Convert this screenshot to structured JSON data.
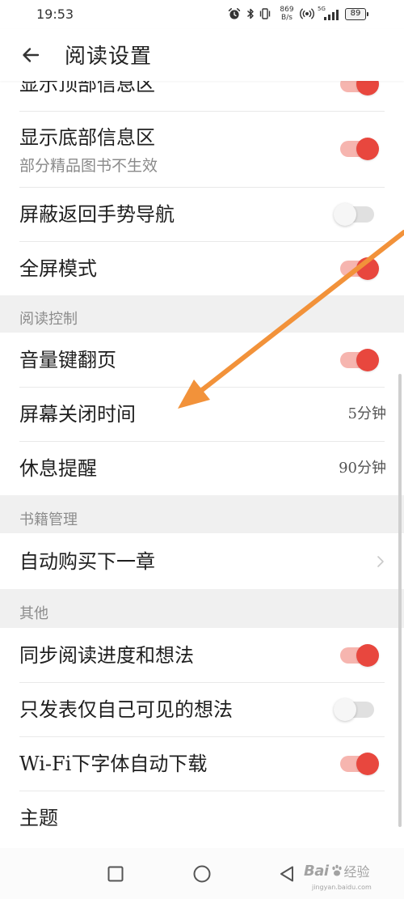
{
  "status_bar": {
    "time": "19:53",
    "net_speed_value": "869",
    "net_speed_unit": "B/s",
    "network_type": "5G",
    "battery": "89",
    "icons": [
      "alarm-icon",
      "bluetooth-icon",
      "vibrate-icon",
      "hotspot-icon",
      "signal-icon",
      "battery-icon"
    ]
  },
  "header": {
    "back_icon": "back-arrow-icon",
    "title": "阅读设置"
  },
  "sections": [
    {
      "items": [
        {
          "label": "显示顶部信息区",
          "toggle_on": true
        },
        {
          "label": "显示底部信息区",
          "sublabel": "部分精品图书不生效",
          "toggle_on": true
        },
        {
          "label": "屏蔽返回手势导航",
          "toggle_on": false
        },
        {
          "label": "全屏模式",
          "toggle_on": true
        }
      ]
    },
    {
      "header": "阅读控制",
      "items": [
        {
          "label": "音量键翻页",
          "toggle_on": true
        },
        {
          "label": "屏幕关闭时间",
          "value": "5分钟"
        },
        {
          "label": "休息提醒",
          "value": "90分钟"
        }
      ]
    },
    {
      "header": "书籍管理",
      "items": [
        {
          "label": "自动购买下一章",
          "icon": "chevron-right-icon"
        }
      ]
    },
    {
      "header": "其他",
      "items": [
        {
          "label": "同步阅读进度和想法",
          "toggle_on": true
        },
        {
          "label": "只发表仅自己可见的想法",
          "toggle_on": false
        },
        {
          "label": "Wi-Fi下字体自动下载",
          "toggle_on": true
        },
        {
          "label": "主题"
        }
      ]
    }
  ],
  "nav_bar": {
    "icons": [
      "recents-square-icon",
      "home-circle-icon",
      "back-triangle-icon"
    ]
  },
  "watermark": {
    "brand_prefix": "Bai",
    "icon": "paw-icon",
    "brand_suffix": "经验",
    "url": "jingyan.baidu.com"
  },
  "colors": {
    "accent": "#e8473e",
    "accent_track": "#f6b5af",
    "section_background": "#f0f0f0",
    "annotation_arrow": "#f2923a"
  }
}
